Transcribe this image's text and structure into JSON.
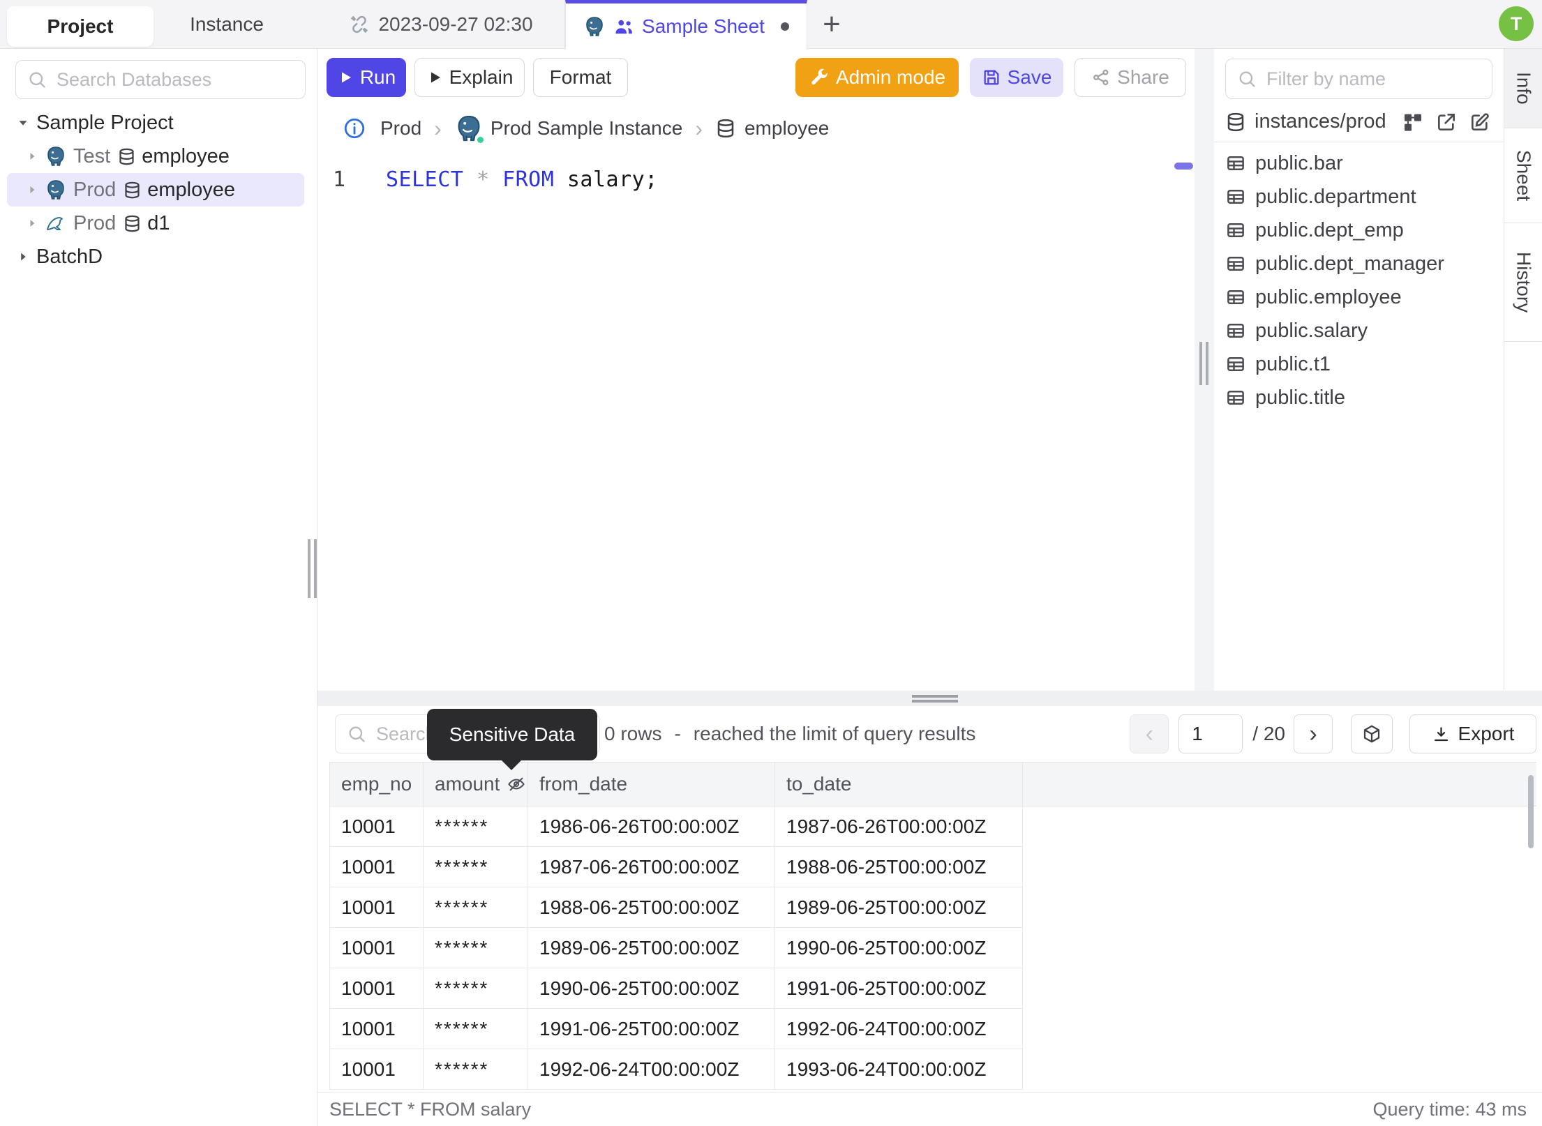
{
  "app": {
    "avatar_initial": "T"
  },
  "left_sidebar": {
    "tabs": [
      {
        "label": "Project",
        "active": true
      },
      {
        "label": "Instance",
        "active": false
      }
    ],
    "search_placeholder": "Search Databases",
    "tree": [
      {
        "kind": "project",
        "label": "Sample Project",
        "state": "expanded"
      },
      {
        "kind": "database",
        "engine": "postgres",
        "environment": "Test",
        "database": "employee",
        "selected": false
      },
      {
        "kind": "database",
        "engine": "postgres",
        "environment": "Prod",
        "database": "employee",
        "selected": true
      },
      {
        "kind": "database",
        "engine": "mysql",
        "environment": "Prod",
        "database": "d1",
        "selected": false
      },
      {
        "kind": "project",
        "label": "BatchD",
        "state": "collapsed"
      }
    ]
  },
  "editor_tabs": {
    "tab1": {
      "label": "2023-09-27 02:30",
      "icon": "unlink-icon"
    },
    "tab2": {
      "label": "Sample Sheet",
      "active": true,
      "unsaved": true
    },
    "new_tab_label": "+"
  },
  "toolbar": {
    "run_label": "Run",
    "explain_label": "Explain",
    "format_label": "Format",
    "admin_mode_label": "Admin mode",
    "save_label": "Save",
    "share_label": "Share"
  },
  "breadcrumb": {
    "environment": "Prod",
    "instance": "Prod Sample Instance",
    "database": "employee",
    "separator": "›"
  },
  "editor": {
    "line_number": "1",
    "sql_tokens": [
      {
        "text": "SELECT",
        "type": "kw"
      },
      {
        "text": " ",
        "type": "plain"
      },
      {
        "text": "*",
        "type": "op"
      },
      {
        "text": " ",
        "type": "plain"
      },
      {
        "text": "FROM",
        "type": "kw"
      },
      {
        "text": " salary;",
        "type": "plain"
      }
    ]
  },
  "right_sidebar": {
    "filter_placeholder": "Filter by name",
    "schema_title": "instances/prod",
    "tables": [
      "public.bar",
      "public.department",
      "public.dept_emp",
      "public.dept_manager",
      "public.employee",
      "public.salary",
      "public.t1",
      "public.title"
    ]
  },
  "side_tabs": [
    {
      "label": "Info",
      "active": true
    },
    {
      "label": "Sheet",
      "active": false
    },
    {
      "label": "History",
      "active": false
    }
  ],
  "results": {
    "search_placeholder": "Search",
    "tooltip_label": "Sensitive Data",
    "rows_count": "0 rows",
    "separator": "-",
    "limit_text": "reached the limit of query results",
    "page": "1",
    "page_total": "/ 20",
    "prev_label": "‹",
    "next_label": "›",
    "export_label": "Export",
    "columns": [
      "emp_no",
      "amount",
      "from_date",
      "to_date"
    ],
    "masked_column": "amount",
    "rows": [
      [
        "10001",
        "******",
        "1986-06-26T00:00:00Z",
        "1987-06-26T00:00:00Z"
      ],
      [
        "10001",
        "******",
        "1987-06-26T00:00:00Z",
        "1988-06-25T00:00:00Z"
      ],
      [
        "10001",
        "******",
        "1988-06-25T00:00:00Z",
        "1989-06-25T00:00:00Z"
      ],
      [
        "10001",
        "******",
        "1989-06-25T00:00:00Z",
        "1990-06-25T00:00:00Z"
      ],
      [
        "10001",
        "******",
        "1990-06-25T00:00:00Z",
        "1991-06-25T00:00:00Z"
      ],
      [
        "10001",
        "******",
        "1991-06-25T00:00:00Z",
        "1992-06-24T00:00:00Z"
      ],
      [
        "10001",
        "******",
        "1992-06-24T00:00:00Z",
        "1993-06-24T00:00:00Z"
      ]
    ],
    "status_left": "SELECT * FROM salary",
    "status_right": "Query time: 43 ms"
  },
  "colors": {
    "accent": "#4f46e5",
    "accent_soft": "#e4e2fb",
    "admin_orange": "#f0a114",
    "avatar_green": "#76c043",
    "keyword_blue": "#2b32de",
    "selected_tree_row": "#e9e8fc",
    "tooltip_bg": "#2b2b2e",
    "status_online_green": "#35d399"
  }
}
